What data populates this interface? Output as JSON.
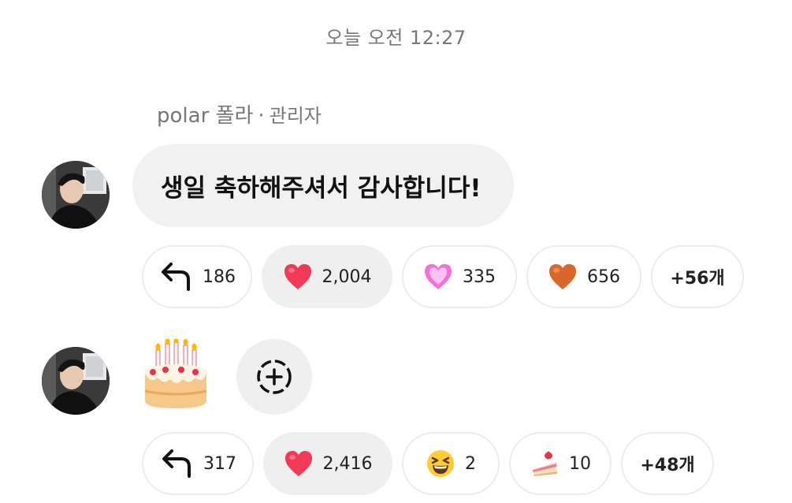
{
  "timestamp": "오늘 오전 12:27",
  "sender": {
    "name": "polar 폴라",
    "separator": "·",
    "role": "관리자"
  },
  "messages": [
    {
      "text": "생일 축하해주셔서 감사합니다!",
      "reactions": {
        "reply_count": "186",
        "items": [
          {
            "icon": "red-heart-icon",
            "count": "2,004",
            "active": true
          },
          {
            "icon": "pink-sparkling-heart-icon",
            "count": "335",
            "active": false
          },
          {
            "icon": "orange-heart-icon",
            "count": "656",
            "active": false
          }
        ],
        "more": "+56개"
      }
    },
    {
      "sticker": "birthday-cake-icon",
      "reactions": {
        "reply_count": "317",
        "items": [
          {
            "icon": "red-heart-icon",
            "count": "2,416",
            "active": true
          },
          {
            "icon": "grinning-squinting-face-icon",
            "count": "2",
            "active": false
          },
          {
            "icon": "shortcake-icon",
            "count": "10",
            "active": false
          }
        ],
        "more": "+48개"
      }
    }
  ],
  "colors": {
    "bubble_bg": "#f1f1f1",
    "chip_border": "#ececec",
    "active_chip_bg": "#efefef",
    "heart_red": "#f23a57",
    "heart_orange": "#d9672b",
    "heart_pink": "#f56fd6"
  }
}
